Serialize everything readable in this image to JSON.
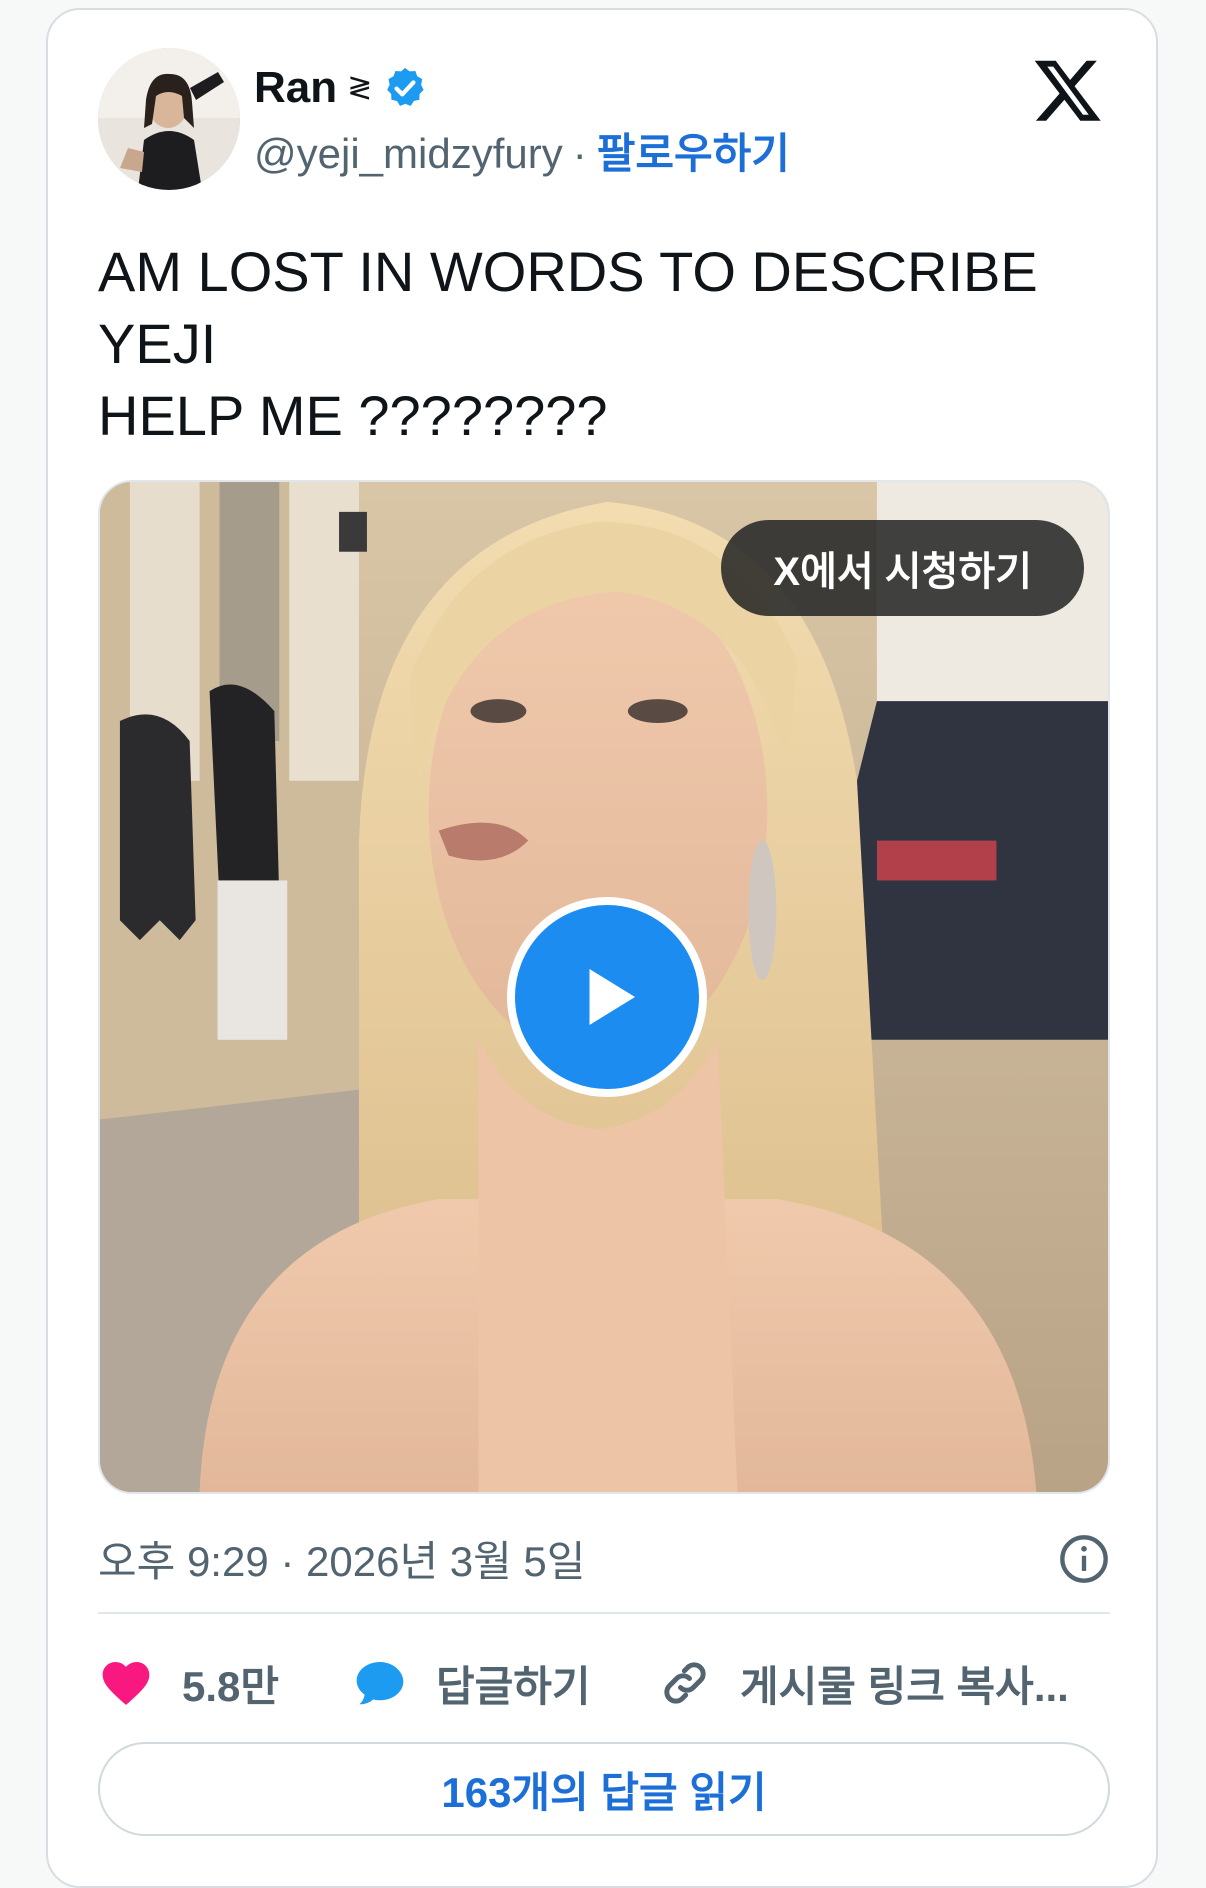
{
  "author": {
    "display_name": "Ran",
    "name_symbol": "≷",
    "verified": true,
    "handle": "@yeji_midzyfury",
    "separator": "·",
    "follow_label": "팔로우하기"
  },
  "tweet": {
    "lines": [
      "AM LOST IN WORDS TO DESCRIBE",
      "YEJI",
      "HELP ME ????????"
    ]
  },
  "media": {
    "watch_label": "X에서 시청하기"
  },
  "meta": {
    "timestamp": "오후 9:29 · 2026년 3월 5일"
  },
  "actions": {
    "like_count": "5.8만",
    "reply_label": "답글하기",
    "copy_link_label": "게시물 링크 복사..."
  },
  "read_replies_label": "163개의 답글 읽기",
  "colors": {
    "accent": "#1d6fd8",
    "like": "#f91880",
    "verified": "#1d9bf0",
    "reply_icon": "#1d9bf0"
  },
  "icons": {
    "logo": "x-logo-icon",
    "verified": "verified-badge-icon",
    "play": "play-icon",
    "info": "info-icon",
    "like": "heart-icon",
    "reply": "chat-bubble-icon",
    "link": "link-icon"
  }
}
